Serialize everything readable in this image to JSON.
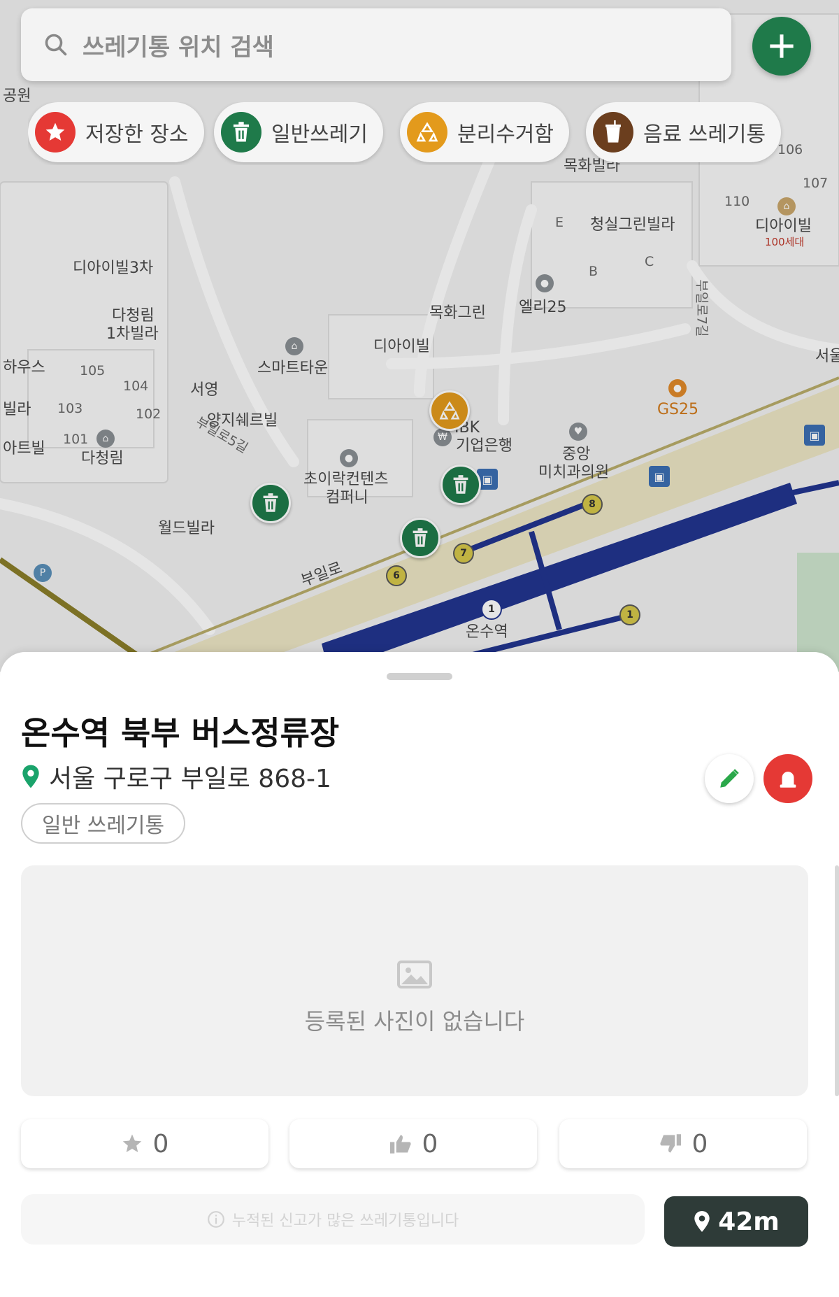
{
  "search": {
    "placeholder": "쓰레기통 위치 검색"
  },
  "filters": [
    {
      "label": "저장한 장소",
      "icon": "star-icon",
      "color": "#e53935"
    },
    {
      "label": "일반쓰레기",
      "icon": "trash-icon",
      "color": "#1f7a4a"
    },
    {
      "label": "분리수거함",
      "icon": "recycle-icon",
      "color": "#e39a1c"
    },
    {
      "label": "음료 쓰레기통",
      "icon": "cup-icon",
      "color": "#6b3e1e"
    }
  ],
  "map": {
    "labels": [
      {
        "text": "디아이빌3차"
      },
      {
        "text": "다청림"
      },
      {
        "text": "1차빌라"
      },
      {
        "text": "스마트타운"
      },
      {
        "text": "서영"
      },
      {
        "text": "양지쉐르빌"
      },
      {
        "text": "디아이빌"
      },
      {
        "text": "목화그린"
      },
      {
        "text": "엘리25"
      },
      {
        "text": "청실그린빌라"
      },
      {
        "text": "목화빌라"
      },
      {
        "text": "디아이빌"
      },
      {
        "text": "100세대"
      },
      {
        "text": "초이락컨텐츠"
      },
      {
        "text": "컴퍼니"
      },
      {
        "text": "IBK"
      },
      {
        "text": "기업은행"
      },
      {
        "text": "중앙"
      },
      {
        "text": "미치과의원"
      },
      {
        "text": "GS25"
      },
      {
        "text": "월드빌라"
      },
      {
        "text": "다청림"
      },
      {
        "text": "부일로"
      },
      {
        "text": "온수역"
      },
      {
        "text": "서울"
      },
      {
        "text": "하우스"
      },
      {
        "text": "빌라"
      },
      {
        "text": "아트빌"
      },
      {
        "text": "공원"
      },
      {
        "text": "부일로5길"
      },
      {
        "text": "부일로7길"
      },
      {
        "text": "101"
      },
      {
        "text": "102"
      },
      {
        "text": "103"
      },
      {
        "text": "104"
      },
      {
        "text": "105"
      },
      {
        "text": "106"
      },
      {
        "text": "107"
      },
      {
        "text": "110"
      },
      {
        "text": "B"
      },
      {
        "text": "C"
      },
      {
        "text": "E"
      }
    ],
    "exits": [
      "1",
      "6",
      "7",
      "8",
      "1"
    ]
  },
  "detail": {
    "title": "온수역 북부 버스정류장",
    "address": "서울 구로구 부일로 868-1",
    "type": "일반 쓰레기통",
    "no_photo": "등록된 사진이 없습니다",
    "stats": {
      "saves": "0",
      "likes": "0",
      "dislikes": "0"
    },
    "notice": "누적된 신고가 많은 쓰레기통입니다",
    "distance": "42m"
  },
  "colors": {
    "primary": "#1f7a4a",
    "danger": "#e53935",
    "dark": "#2e3b38",
    "subway": "#22358f",
    "road": "#ece6c4"
  }
}
